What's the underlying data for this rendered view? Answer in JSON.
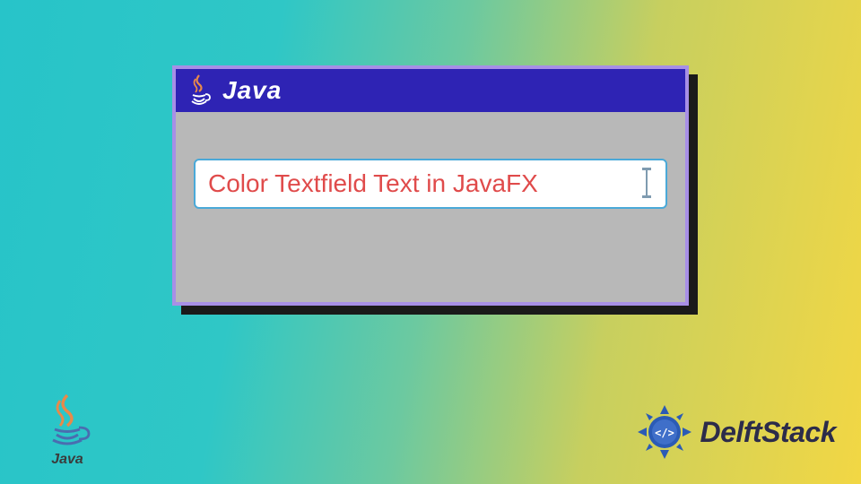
{
  "window": {
    "title": "Java",
    "titlebar_color": "#2e23b4",
    "border_color": "#a78fe6",
    "body_bg": "#b8b8b8"
  },
  "textfield": {
    "value": "Color Textfield Text in JavaFX",
    "text_color": "#e04b4b",
    "border_color": "#4aa9d8",
    "bg": "#ffffff"
  },
  "logos": {
    "java_small_label": "Java",
    "delft_label": "DelftStack"
  }
}
